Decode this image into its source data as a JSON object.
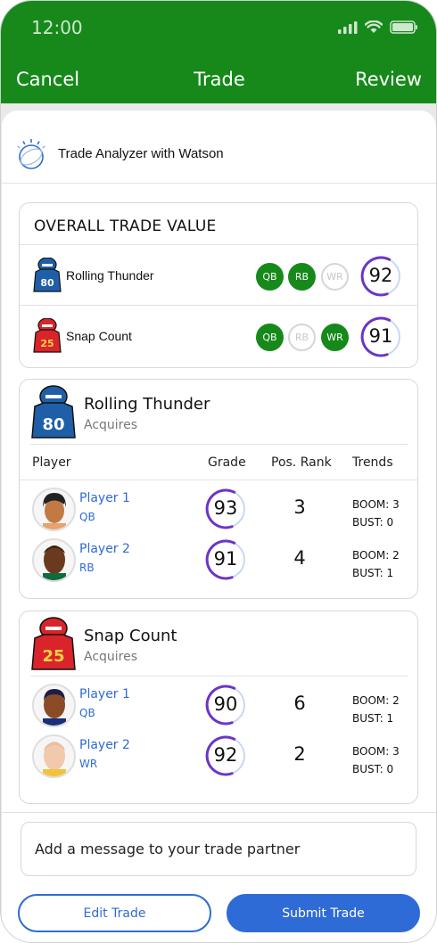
{
  "status_bar": {
    "time": "12:00",
    "icons": [
      "signal-icon",
      "wifi-icon",
      "battery-icon"
    ]
  },
  "nav": {
    "cancel": "Cancel",
    "title": "Trade",
    "review": "Review"
  },
  "analyzer": {
    "title": "Trade Analyzer with Watson",
    "icon": "watson-logo-icon"
  },
  "overall": {
    "title": "OVERALL TRADE VALUE",
    "teams": [
      {
        "name": "Rolling Thunder",
        "jersey_number": "80",
        "jersey_color": "#1f5fa8",
        "positions": [
          {
            "label": "QB",
            "active": true
          },
          {
            "label": "RB",
            "active": true
          },
          {
            "label": "WR",
            "active": false
          }
        ],
        "value": "92"
      },
      {
        "name": "Snap Count",
        "jersey_number": "25",
        "jersey_color": "#d9242b",
        "positions": [
          {
            "label": "QB",
            "active": true
          },
          {
            "label": "RB",
            "active": false
          },
          {
            "label": "WR",
            "active": true
          }
        ],
        "value": "91"
      }
    ]
  },
  "acquisitions": [
    {
      "team": "Rolling Thunder",
      "subtitle": "Acquires",
      "jersey_number": "80",
      "jersey_color": "#1f5fa8",
      "columns": [
        "Player",
        "Grade",
        "Pos. Rank",
        "Trends"
      ],
      "players": [
        {
          "name": "Player 1",
          "pos": "QB",
          "grade": "93",
          "rank": "3",
          "boom": "BOOM: 3",
          "bust": "BUST: 0"
        },
        {
          "name": "Player 2",
          "pos": "RB",
          "grade": "91",
          "rank": "4",
          "boom": "BOOM: 2",
          "bust": "BUST: 1"
        }
      ]
    },
    {
      "team": "Snap Count",
      "subtitle": "Acquires",
      "jersey_number": "25",
      "jersey_color": "#d9242b",
      "players": [
        {
          "name": "Player 1",
          "pos": "QB",
          "grade": "90",
          "rank": "6",
          "boom": "BOOM: 2",
          "bust": "BUST: 1"
        },
        {
          "name": "Player 2",
          "pos": "WR",
          "grade": "92",
          "rank": "2",
          "boom": "BOOM: 3",
          "bust": "BUST: 0"
        }
      ]
    }
  ],
  "message": {
    "placeholder": "Add a message to your trade partner",
    "value": ""
  },
  "buttons": {
    "edit": "Edit Trade",
    "submit": "Submit Trade"
  },
  "colors": {
    "brand_green": "#16891a",
    "accent_blue": "#2f6bd6",
    "grade_purple": "#6a35c9"
  }
}
